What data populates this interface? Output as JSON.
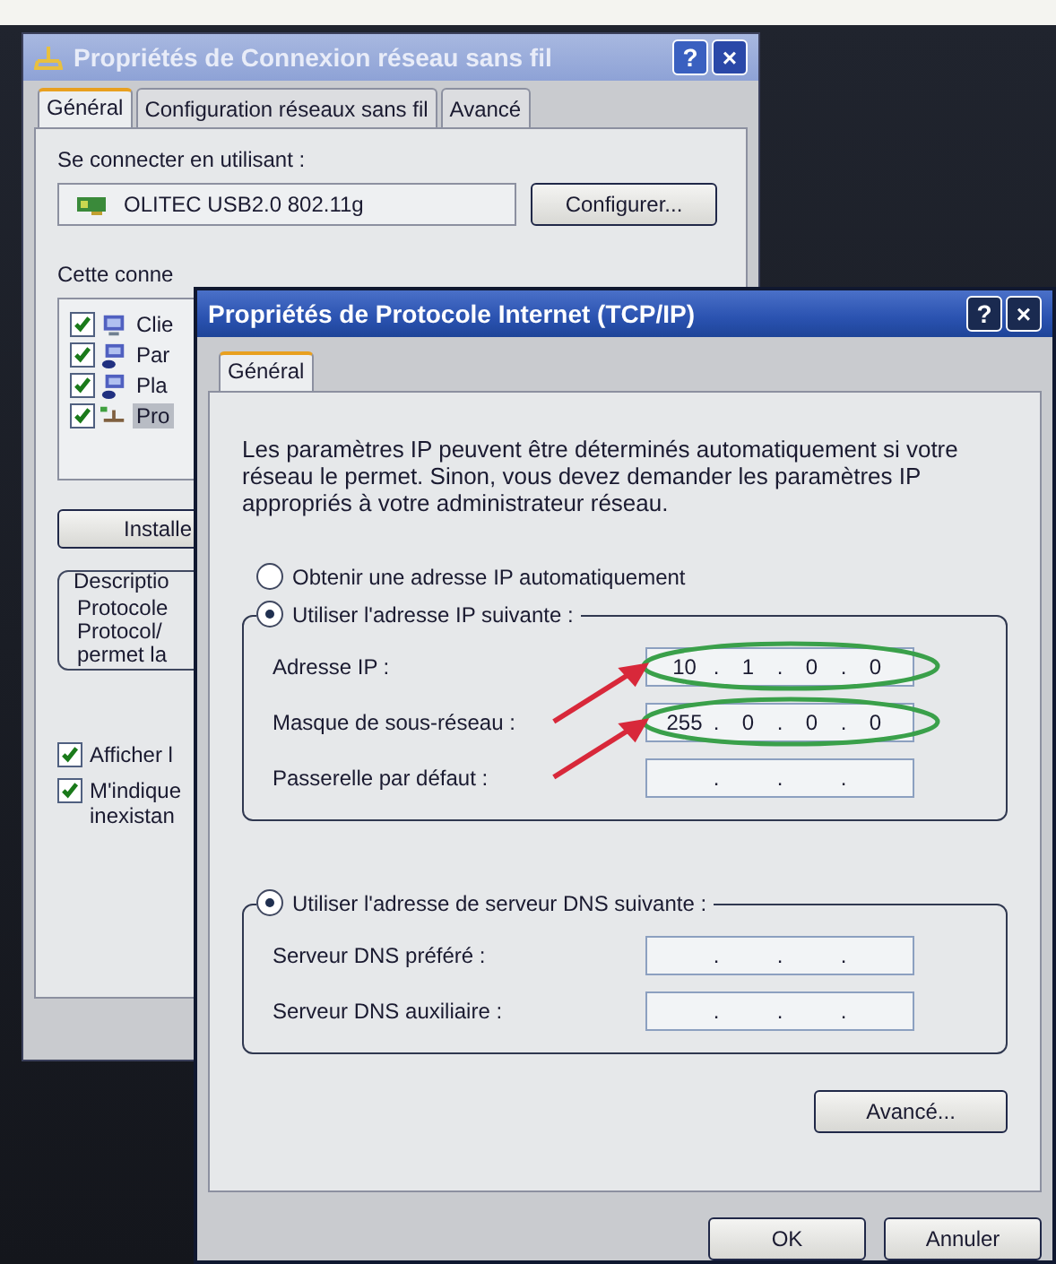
{
  "back_window": {
    "title": "Propriétés de Connexion réseau sans fil",
    "title_buttons": [
      "?",
      "×"
    ],
    "tabs": [
      {
        "label": "Général",
        "selected": true
      },
      {
        "label": "Configuration réseaux sans fil",
        "selected": false
      },
      {
        "label": "Avancé",
        "selected": false
      }
    ],
    "connect_label": "Se connecter en utilisant :",
    "adapter": "OLITEC USB2.0 802.11g",
    "configure_button": "Configurer...",
    "components_label": "Cette conne",
    "components": [
      {
        "label": "Clie",
        "kind": "client",
        "checked": true,
        "selected": false
      },
      {
        "label": "Par",
        "kind": "service",
        "checked": true,
        "selected": false
      },
      {
        "label": "Pla",
        "kind": "service",
        "checked": true,
        "selected": false
      },
      {
        "label": "Pro",
        "kind": "protocol",
        "checked": true,
        "selected": true
      }
    ],
    "install_button": "Installe",
    "description": {
      "legend": "Descriptio",
      "lines": [
        "Protocole",
        "Protocol/",
        "permet la"
      ]
    },
    "options": [
      {
        "label": "Afficher l",
        "checked": true
      },
      {
        "label": "M'indique",
        "checked": true,
        "continuation": "inexistan"
      }
    ]
  },
  "front_window": {
    "title": "Propriétés de Protocole Internet (TCP/IP)",
    "title_buttons": [
      "?",
      "×"
    ],
    "tabs": [
      {
        "label": "Général",
        "selected": true
      }
    ],
    "intro": "Les paramètres IP peuvent être déterminés automatiquement si votre réseau le permet. Sinon, vous devez demander les paramètres IP appropriés à votre administrateur réseau.",
    "ip_mode": [
      {
        "label": "Obtenir une adresse IP automatiquement",
        "selected": false
      },
      {
        "label": "Utiliser l'adresse IP suivante :",
        "selected": true
      }
    ],
    "ip_fields": [
      {
        "label": "Adresse IP :",
        "octets": [
          "10",
          "1",
          "0",
          "0"
        ],
        "dots": [
          ".",
          ".",
          "."
        ],
        "annotated": true
      },
      {
        "label": "Masque de sous-réseau :",
        "octets": [
          "255",
          "0",
          "0",
          "0"
        ],
        "dots": [
          ".",
          ".",
          "."
        ],
        "annotated": true
      },
      {
        "label": "Passerelle par défaut :",
        "dots": [
          ".",
          ".",
          "."
        ],
        "annotated": false
      }
    ],
    "dns_mode": {
      "label": "Utiliser l'adresse de serveur DNS suivante :",
      "selected": true
    },
    "dns_fields": [
      {
        "label": "Serveur DNS préféré :",
        "dots": [
          ".",
          ".",
          "."
        ],
        "annotated": false
      },
      {
        "label": "Serveur DNS auxiliaire :",
        "dots": [
          ".",
          ".",
          "."
        ],
        "annotated": false
      }
    ],
    "advanced_button": "Avancé...",
    "ok_button": "OK",
    "cancel_button": "Annuler"
  }
}
